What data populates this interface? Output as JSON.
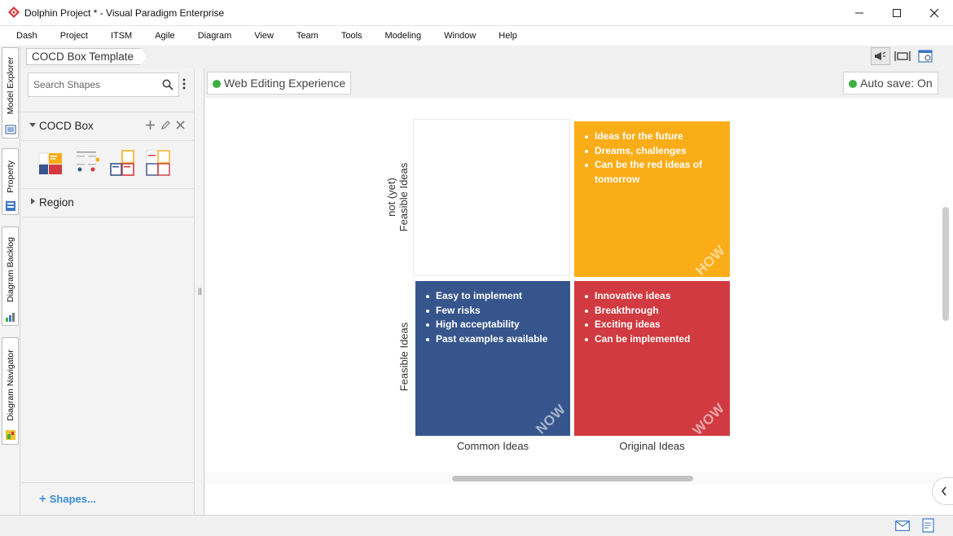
{
  "window": {
    "title": "Dolphin Project * - Visual Paradigm Enterprise"
  },
  "menu": [
    "Dash",
    "Project",
    "ITSM",
    "Agile",
    "Diagram",
    "View",
    "Team",
    "Tools",
    "Modeling",
    "Window",
    "Help"
  ],
  "side_tabs": [
    "Model Explorer",
    "Property",
    "Diagram Backlog",
    "Diagram Navigator"
  ],
  "breadcrumb": "COCD Box Template",
  "left_panel": {
    "search_placeholder": "Search Shapes",
    "group_cocd": "COCD Box",
    "group_region": "Region",
    "shapes_link": "Shapes..."
  },
  "canvas": {
    "web_editing": "Web Editing Experience",
    "auto_save": "Auto save: On"
  },
  "cocd": {
    "axis_not_yet_line1": "not (yet)",
    "axis_not_yet_line2": "Feasible Ideas",
    "axis_feasible": "Feasible Ideas",
    "axis_common": "Common Ideas",
    "axis_original": "Original Ideas",
    "how": {
      "tag": "HOW",
      "color": "#fbad18",
      "items": [
        "Ideas for the future",
        "Dreams, challenges",
        "Can be the red ideas of tomorrow"
      ]
    },
    "now": {
      "tag": "NOW",
      "color": "#36558c",
      "items": [
        "Easy to implement",
        "Few risks",
        "High acceptability",
        "Past examples available"
      ]
    },
    "wow": {
      "tag": "WOW",
      "color": "#d13a40",
      "items": [
        "Innovative ideas",
        "Breakthrough",
        "Exciting ideas",
        "Can be implemented"
      ]
    }
  },
  "colors": {
    "accent_blue": "#3c8dd8",
    "status_green": "#3cb043"
  }
}
